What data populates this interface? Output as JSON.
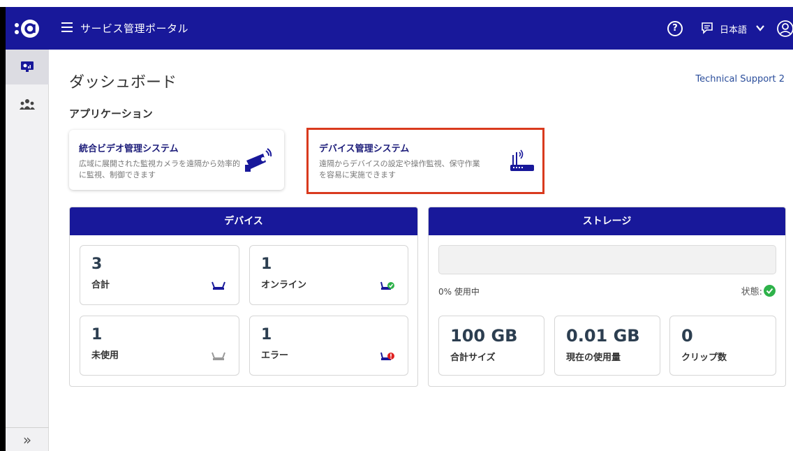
{
  "header": {
    "title": "サービス管理ポータル",
    "language": "日本語"
  },
  "page": {
    "title": "ダッシュボード",
    "support_link": "Technical Support 2"
  },
  "applications": {
    "section_title": "アプリケーション",
    "cards": [
      {
        "name": "統合ビデオ管理システム",
        "description": "広域に展開された監視カメラを遠隔から効率的に監視、制御できます",
        "icon": "cctv-camera-icon"
      },
      {
        "name": "デバイス管理システム",
        "description": "遠隔からデバイスの設定や操作監視、保守作業を容易に実施できます",
        "icon": "router-icon"
      }
    ]
  },
  "devices": {
    "title": "デバイス",
    "stats": [
      {
        "value": "3",
        "label": "合計",
        "icon": "router-icon"
      },
      {
        "value": "1",
        "label": "オンライン",
        "icon": "router-online-icon"
      },
      {
        "value": "1",
        "label": "未使用",
        "icon": "router-unused-icon"
      },
      {
        "value": "1",
        "label": "エラー",
        "icon": "router-error-icon"
      }
    ]
  },
  "storage": {
    "title": "ストレージ",
    "usage_text": "0% 使用中",
    "usage_percent": 0,
    "status_label": "状態:",
    "stats": [
      {
        "value": "100 GB",
        "label": "合計サイズ"
      },
      {
        "value": "0.01 GB",
        "label": "現在の使用量"
      },
      {
        "value": "0",
        "label": "クリップ数"
      }
    ]
  },
  "colors": {
    "primary": "#18189a",
    "highlight": "#d93a1e",
    "success": "#2eb24a",
    "error": "#e02020"
  }
}
